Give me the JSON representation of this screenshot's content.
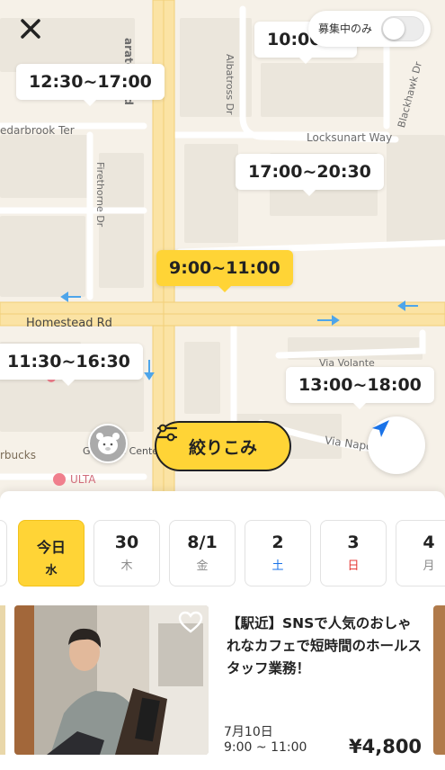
{
  "header": {
    "close_label": "×"
  },
  "toggle": {
    "label": "募集中のみ",
    "on": false
  },
  "map": {
    "streets": {
      "saratoga": "aratoga Rd",
      "cedarbrook": "edarbrook Ter",
      "firethorne": "Firethorne Dr",
      "albatross": "Albatross Dr",
      "locksunart": "Locksunart Way",
      "blackhawk": "Blackhawk Dr",
      "homestead": "Homestead Rd",
      "via_volante": "Via Volante",
      "via_napoli": "Via Napo",
      "starbucks": "rbucks",
      "ulta": "ULTA",
      "service_center": "G    Aut  Se    Cente"
    },
    "pins": [
      {
        "label": "10:00",
        "active": false
      },
      {
        "label": "12:30~17:00",
        "active": false
      },
      {
        "label": "17:00~20:30",
        "active": false
      },
      {
        "label": "9:00~11:00",
        "active": true
      },
      {
        "label": "11:30~16:30",
        "active": false
      },
      {
        "label": "13:00~18:00",
        "active": false
      }
    ]
  },
  "filter": {
    "label": "絞りこみ"
  },
  "dates": [
    {
      "num": "今日",
      "dow": "水",
      "selected": true
    },
    {
      "num": "30",
      "dow": "木"
    },
    {
      "num": "8/1",
      "dow": "金"
    },
    {
      "num": "2",
      "dow": "土",
      "color": "#1a73e8"
    },
    {
      "num": "3",
      "dow": "日",
      "color": "#e53935"
    },
    {
      "num": "4",
      "dow": "月"
    }
  ],
  "job": {
    "title": "【駅近】SNSで人気のおしゃれなカフェで短時間のホールスタッフ業務！",
    "date": "7月10日",
    "time": "9:00 ~ 11:00",
    "price": "¥4,800"
  },
  "colors": {
    "accent": "#ffd436",
    "saturday": "#1a73e8",
    "sunday": "#e53935",
    "locate": "#1a73e8"
  }
}
